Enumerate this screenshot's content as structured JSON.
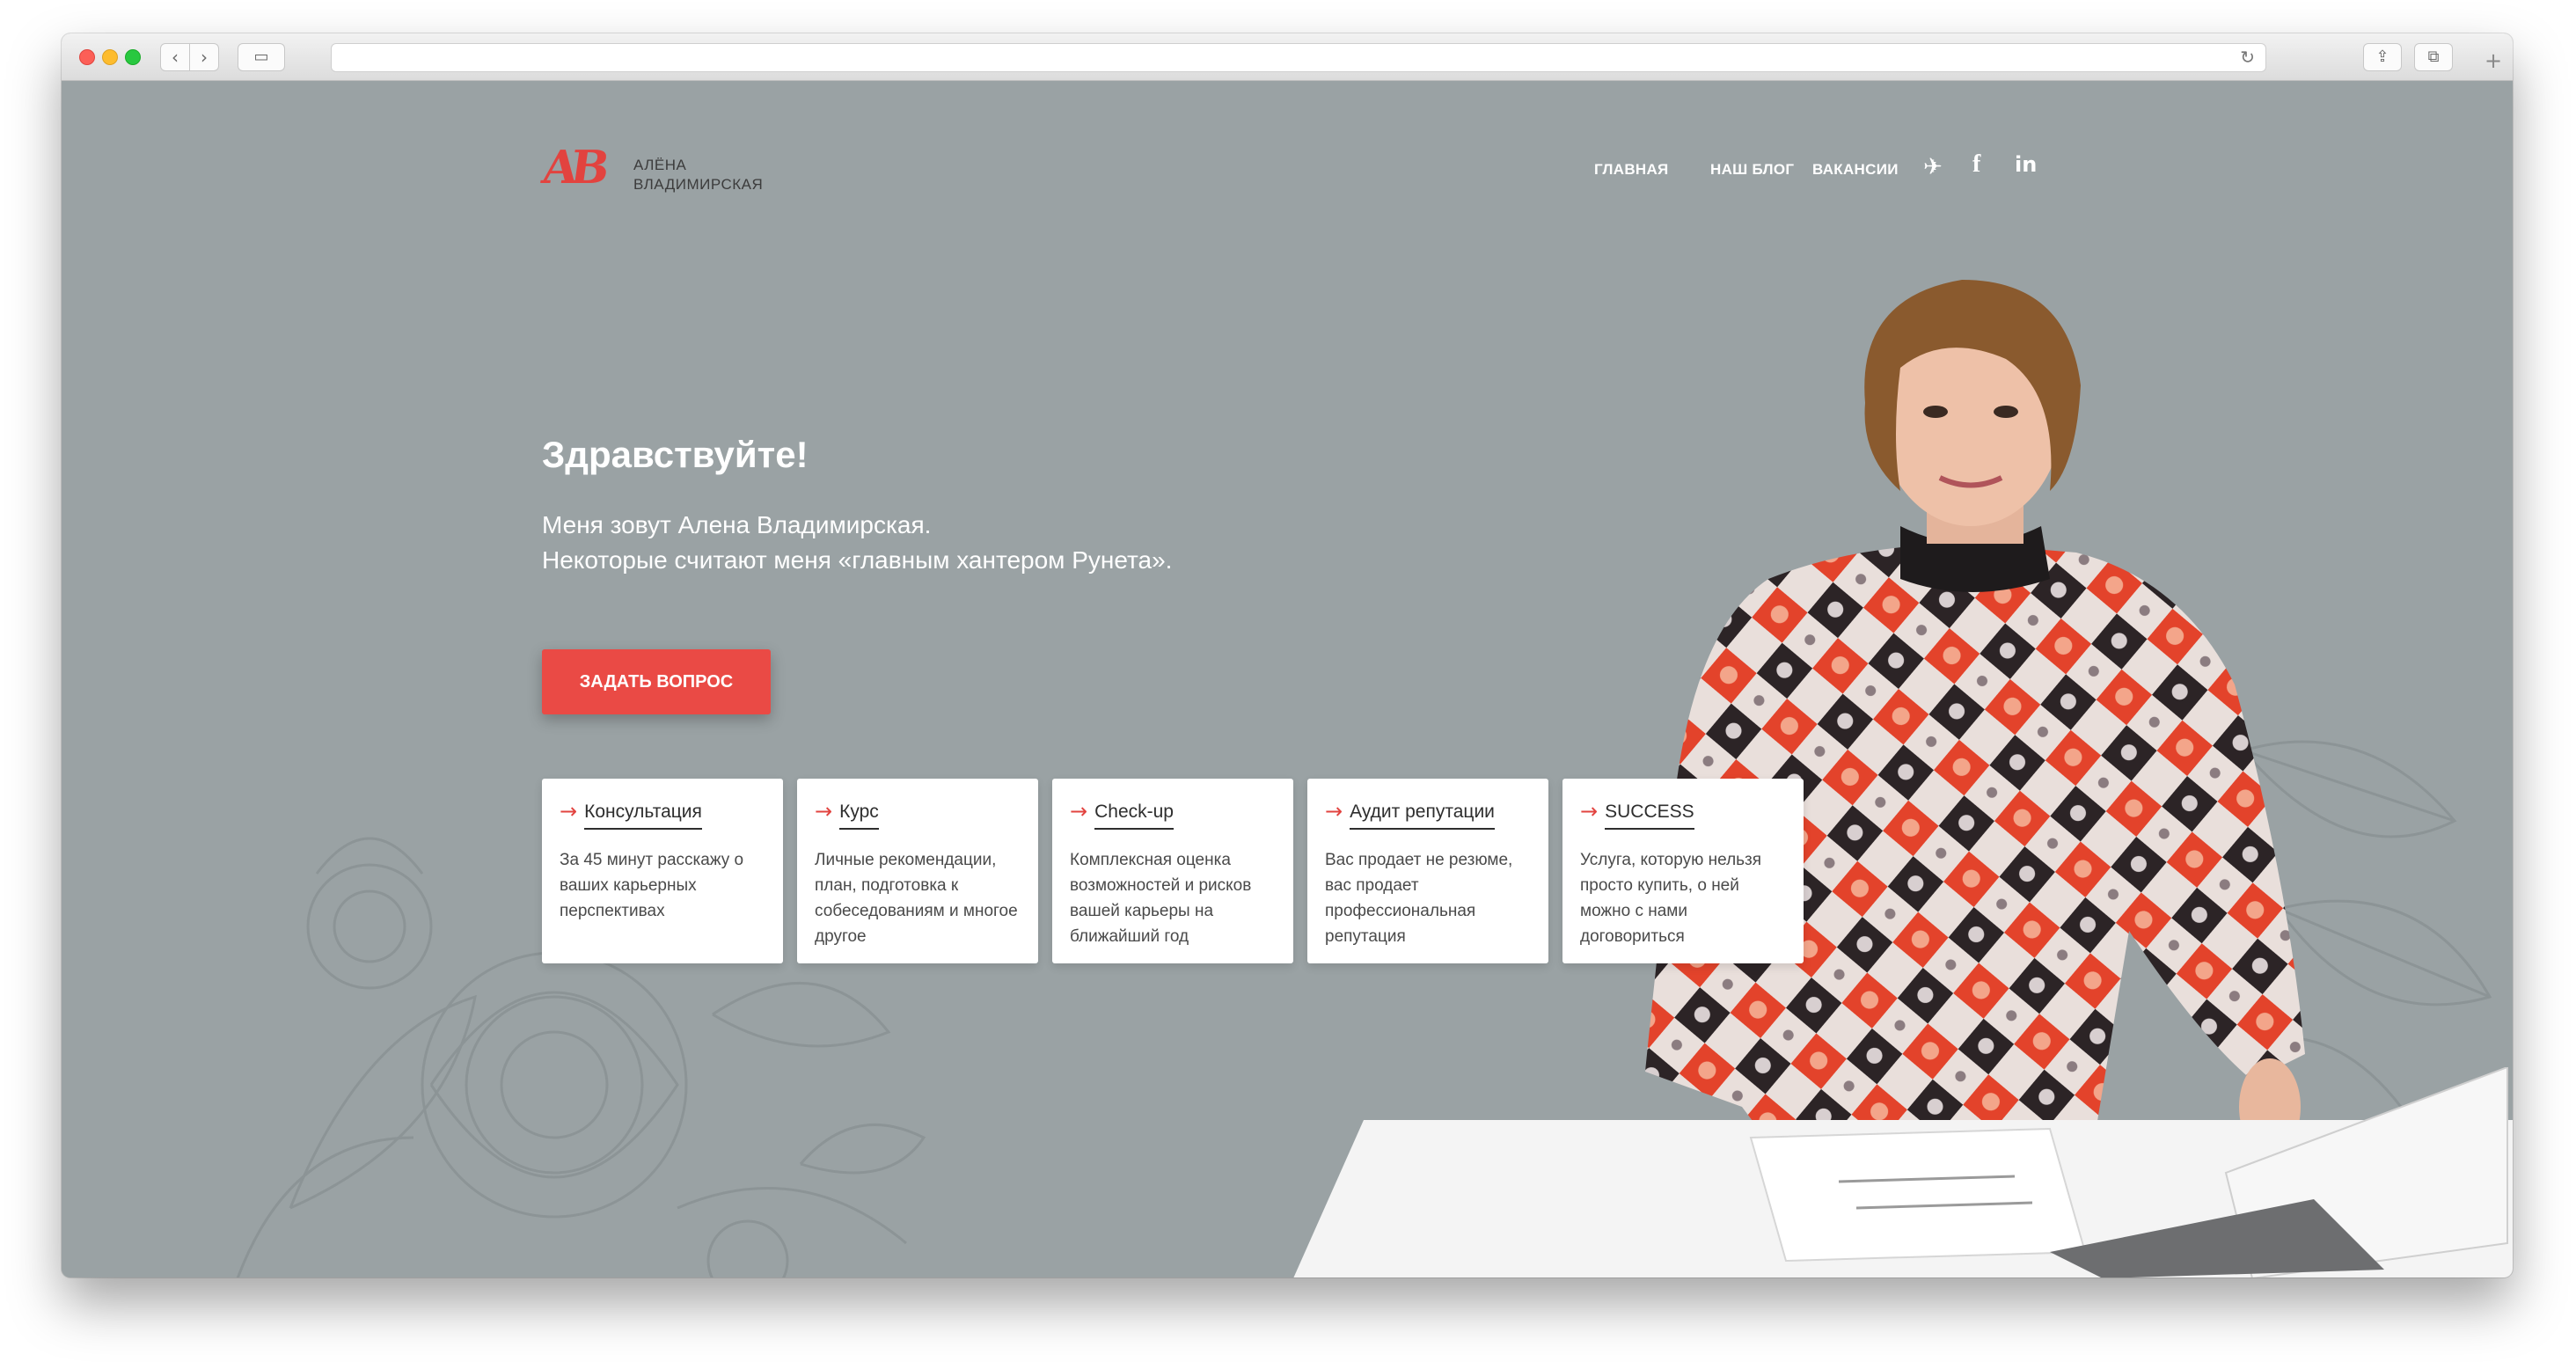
{
  "browser": {
    "back_icon": "‹",
    "forward_icon": "›",
    "sidebar_icon": "▭",
    "reload_icon": "↻",
    "share_icon": "⇪",
    "tabs_icon": "⧉",
    "newtab_icon": "+"
  },
  "site": {
    "logo": {
      "mark": "АВ",
      "name_line1": "АЛЁНА",
      "name_line2": "ВЛАДИМИРСКАЯ"
    },
    "nav": {
      "home": "ГЛАВНАЯ",
      "blog": "НАШ БЛОГ",
      "jobs": "ВАКАНСИИ"
    },
    "social": {
      "telegram": "✈",
      "facebook": "f",
      "linkedin": "in"
    },
    "hero": {
      "title": "Здравствуйте!",
      "line1": "Меня зовут Алена Владимирская.",
      "line2": "Некоторые считают меня «главным хантером Рунета».",
      "cta": "ЗАДАТЬ ВОПРОС"
    },
    "cards": [
      {
        "title": "Консультация",
        "text": "За 45 минут расскажу о ваших карьерных перспективах"
      },
      {
        "title": "Курс",
        "text": "Личные рекомендации, план, подготовка к собеседованиям и многое другое"
      },
      {
        "title": "Check-up",
        "text": "Комплексная оценка возможностей и рисков вашей карьеры на ближайший год"
      },
      {
        "title": "Аудит репутации",
        "text": "Вас продает не резюме, вас продает профессиональная репутация"
      },
      {
        "title": "SUCCESS",
        "text": "Услуга, которую нельзя просто купить, о ней можно с нами договориться"
      }
    ],
    "card_arrow": "→"
  },
  "colors": {
    "background": "#9aa2a4",
    "accent": "#ea4a45",
    "card": "#ffffff"
  }
}
